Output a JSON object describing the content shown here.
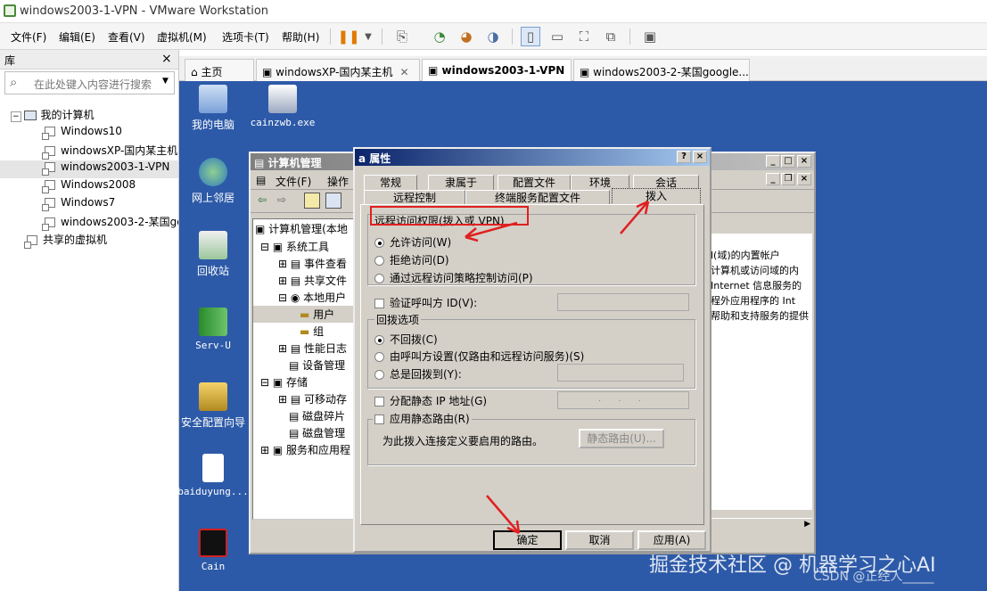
{
  "window_title": "windows2003-1-VPN - VMware Workstation",
  "menu": [
    "文件(F)",
    "编辑(E)",
    "查看(V)",
    "虚拟机(M)",
    "选项卡(T)",
    "帮助(H)"
  ],
  "library": {
    "title": "库",
    "close": "×",
    "search_placeholder": "在此处键入内容进行搜索",
    "tree": [
      {
        "label": "我的计算机"
      },
      {
        "label": "Windows10"
      },
      {
        "label": "windowsXP-国内某主机"
      },
      {
        "label": "windows2003-1-VPN"
      },
      {
        "label": "Windows2008"
      },
      {
        "label": "Windows7"
      },
      {
        "label": "windows2003-2-某国google"
      },
      {
        "label": "共享的虚拟机"
      }
    ]
  },
  "tabs": [
    {
      "label": "主页"
    },
    {
      "label": "windowsXP-国内某主机"
    },
    {
      "label": "windows2003-1-VPN"
    },
    {
      "label": "windows2003-2-某国google..."
    }
  ],
  "desktop_icons": [
    {
      "label": "我的电脑"
    },
    {
      "label": "cainzwb.exe"
    },
    {
      "label": "网上邻居"
    },
    {
      "label": "回收站"
    },
    {
      "label": "Serv-U"
    },
    {
      "label": "安全配置向导"
    },
    {
      "label": "baiduyung..."
    },
    {
      "label": "Cain"
    }
  ],
  "mgmt": {
    "title": "计算机管理",
    "menu": [
      "文件(F)",
      "操作"
    ],
    "tree": [
      "计算机管理(本地",
      "系统工具",
      "事件查看",
      "共享文件",
      "本地用户",
      "用户",
      "组",
      "性能日志",
      "设备管理",
      "存储",
      "可移动存",
      "磁盘碎片",
      "磁盘管理",
      "服务和应用程"
    ],
    "right_lines": [
      "l(域)的内置帐户",
      "计算机或访问域的内",
      "Internet 信息服务的",
      "程外应用程序的 Int",
      "帮助和支持服务的提供"
    ]
  },
  "dialog": {
    "title": "属性",
    "title_prefix": "a",
    "tabs_row1": [
      "常规",
      "隶属于",
      "配置文件",
      "环境",
      "会话"
    ],
    "tabs_row2": [
      "远程控制",
      "终端服务配置文件",
      "拨入"
    ],
    "remote_access_title": "远程访问权限(拨入或 VPN)",
    "ra_options": [
      "允许访问(W)",
      "拒绝访问(D)",
      "通过远程访问策略控制访问(P)"
    ],
    "verify_caller": "验证呼叫方 ID(V):",
    "callback_title": "回拨选项",
    "callback_options": [
      "不回拨(C)",
      "由呼叫方设置(仅路由和远程访问服务)(S)",
      "总是回拨到(Y):"
    ],
    "static_ip": "分配静态 IP 地址(G)",
    "static_route": "应用静态路由(R)",
    "static_route_desc": "为此拨入连接定义要启用的路由。",
    "static_route_btn": "静态路由(U)...",
    "ip_dots": ". . .",
    "ok": "确定",
    "cancel": "取消",
    "apply": "应用(A)"
  },
  "watermark": "掘金技术社区 @ 机器学习之心AI",
  "watermark2": "CSDN @正经人_____"
}
